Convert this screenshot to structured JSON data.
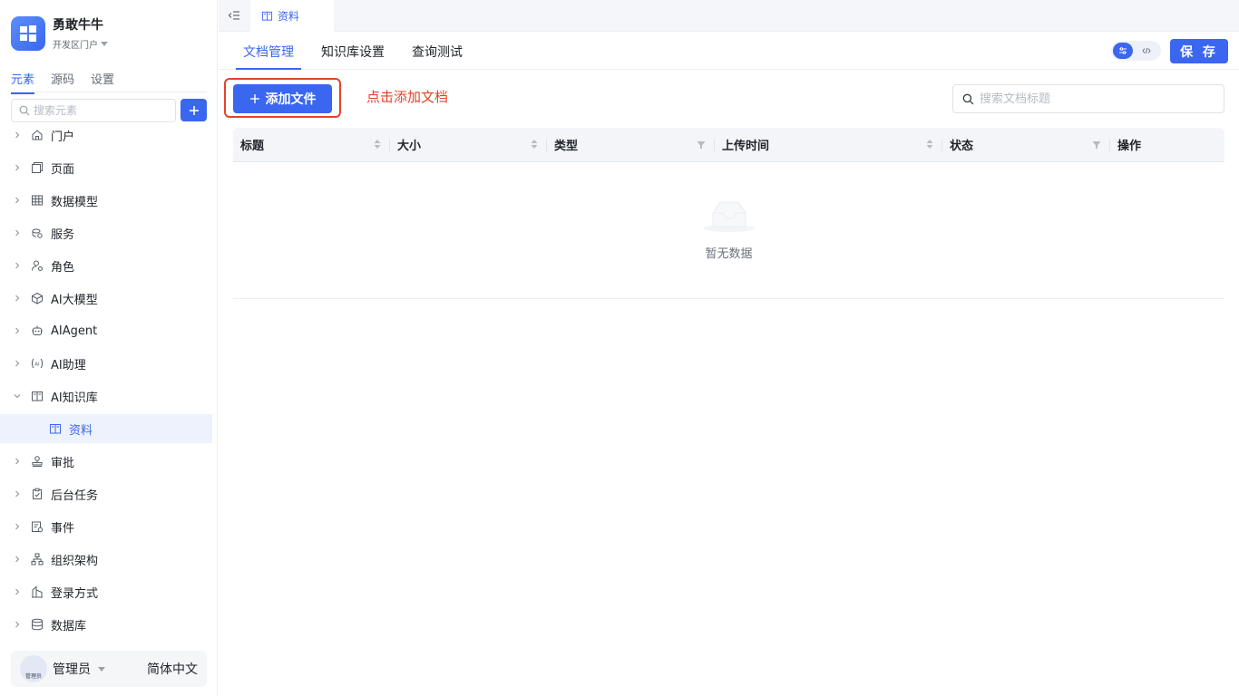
{
  "app": {
    "name": "勇敢牛牛",
    "subtitle": "开发区门户"
  },
  "sidebar": {
    "tabs": [
      {
        "label": "元素",
        "active": true
      },
      {
        "label": "源码",
        "active": false
      },
      {
        "label": "设置",
        "active": false
      }
    ],
    "search_placeholder": "搜索元素",
    "tree": [
      {
        "label": "门户",
        "icon": "home-icon"
      },
      {
        "label": "页面",
        "icon": "pages-icon"
      },
      {
        "label": "数据模型",
        "icon": "table-icon"
      },
      {
        "label": "服务",
        "icon": "service-icon"
      },
      {
        "label": "角色",
        "icon": "role-icon"
      },
      {
        "label": "AI大模型",
        "icon": "cube-icon"
      },
      {
        "label": "AIAgent",
        "icon": "robot-icon"
      },
      {
        "label": "AI助理",
        "icon": "ai-assistant-icon"
      },
      {
        "label": "AI知识库",
        "icon": "book-icon",
        "expanded": true
      },
      {
        "label": "资料",
        "icon": "book-icon",
        "child": true,
        "selected": true
      },
      {
        "label": "审批",
        "icon": "stamp-icon"
      },
      {
        "label": "后台任务",
        "icon": "clipboard-icon"
      },
      {
        "label": "事件",
        "icon": "event-icon"
      },
      {
        "label": "组织架构",
        "icon": "org-icon"
      },
      {
        "label": "登录方式",
        "icon": "login-icon"
      },
      {
        "label": "数据库",
        "icon": "database-icon"
      }
    ],
    "user": {
      "name": "管理员",
      "avatar_text": "管理员",
      "language": "简体中文"
    }
  },
  "topbar": {
    "page_tab": "资料"
  },
  "subnav": {
    "tabs": [
      {
        "label": "文档管理",
        "active": true
      },
      {
        "label": "知识库设置",
        "active": false
      },
      {
        "label": "查询测试",
        "active": false
      }
    ],
    "save_label": "保 存"
  },
  "toolbar": {
    "add_file_label": "添加文件",
    "annotation": "点击添加文档",
    "search_placeholder": "搜索文档标题"
  },
  "table": {
    "columns": [
      "标题",
      "大小",
      "类型",
      "上传时间",
      "状态",
      "操作"
    ],
    "empty_text": "暂无数据"
  },
  "colors": {
    "accent": "#3a66f0",
    "annotation": "#e0442a"
  }
}
